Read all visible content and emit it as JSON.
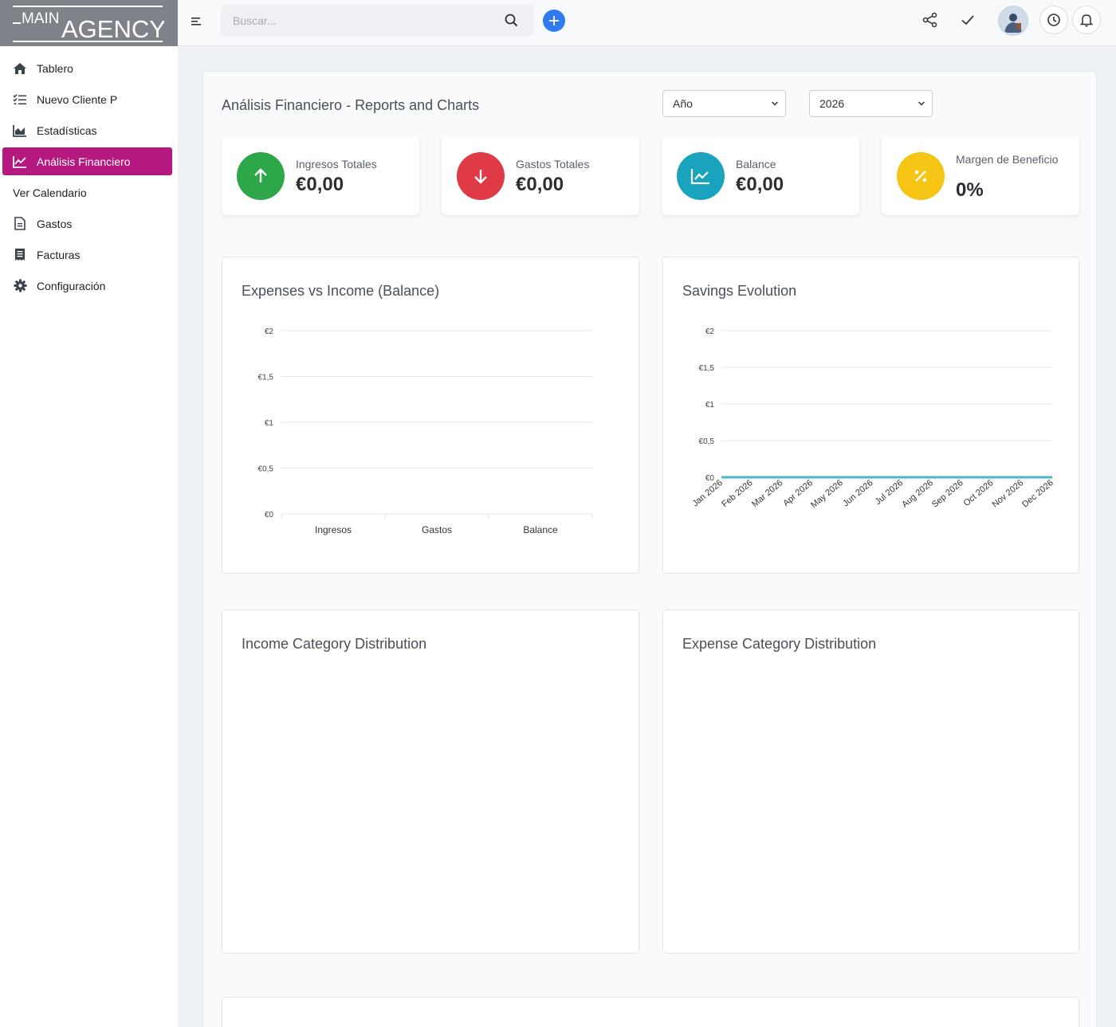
{
  "logo": {
    "text_main": "MAIN",
    "text_agency": "AGENCY"
  },
  "sidebar": {
    "items": [
      {
        "label": "Tablero",
        "icon": "home-icon",
        "active": false
      },
      {
        "label": "Nuevo Cliente P",
        "icon": "checklist-icon",
        "active": false
      },
      {
        "label": "Estadísticas",
        "icon": "area-chart-icon",
        "active": false
      },
      {
        "label": "Análisis Financiero",
        "icon": "line-chart-icon",
        "active": true
      },
      {
        "label": "Ver Calendario",
        "icon": "",
        "active": false
      },
      {
        "label": "Gastos",
        "icon": "document-icon",
        "active": false
      },
      {
        "label": "Facturas",
        "icon": "receipt-icon",
        "active": false
      },
      {
        "label": "Configuración",
        "icon": "gear-icon",
        "active": false
      }
    ]
  },
  "topbar": {
    "search_placeholder": "Buscar..."
  },
  "page": {
    "title": "Análisis Financiero - Reports and Charts",
    "period_select": "Año",
    "year_select": "2026"
  },
  "stats": [
    {
      "label": "Ingresos Totales",
      "value": "€0,00",
      "color": "#2ea64a",
      "icon": "arrow-up-icon"
    },
    {
      "label": "Gastos Totales",
      "value": "€0,00",
      "color": "#e03a47",
      "icon": "arrow-down-icon"
    },
    {
      "label": "Balance",
      "value": "€0,00",
      "color": "#1aa3bd",
      "icon": "trend-icon"
    },
    {
      "label": "Margen de Beneficio",
      "value": "0%",
      "color": "#f5c414",
      "icon": "percent-icon"
    }
  ],
  "panels": {
    "balance_title": "Expenses vs Income (Balance)",
    "savings_title": "Savings Evolution",
    "income_dist_title": "Income Category Distribution",
    "expense_dist_title": "Expense Category Distribution"
  },
  "chart_data": [
    {
      "type": "bar",
      "title": "Expenses vs Income (Balance)",
      "categories": [
        "Ingresos",
        "Gastos",
        "Balance"
      ],
      "values": [
        0,
        0,
        0
      ],
      "ylim": [
        0,
        2
      ],
      "yticks": [
        "€0",
        "€0,5",
        "€1",
        "€1,5",
        "€2"
      ],
      "ytick_values": [
        0,
        0.5,
        1,
        1.5,
        2
      ],
      "grid": true
    },
    {
      "type": "line",
      "title": "Savings Evolution",
      "x": [
        "Jan 2026",
        "Feb 2026",
        "Mar 2026",
        "Apr 2026",
        "May 2026",
        "Jun 2026",
        "Jul 2026",
        "Aug 2026",
        "Sep 2026",
        "Oct 2026",
        "Nov 2026",
        "Dec 2026"
      ],
      "values": [
        0,
        0,
        0,
        0,
        0,
        0,
        0,
        0,
        0,
        0,
        0,
        0
      ],
      "ylim": [
        0,
        2
      ],
      "yticks": [
        "€0",
        "€0,5",
        "€1",
        "€1,5",
        "€2"
      ],
      "ytick_values": [
        0,
        0.5,
        1,
        1.5,
        2
      ],
      "line_color": "#4bb8c9",
      "grid": true
    }
  ]
}
